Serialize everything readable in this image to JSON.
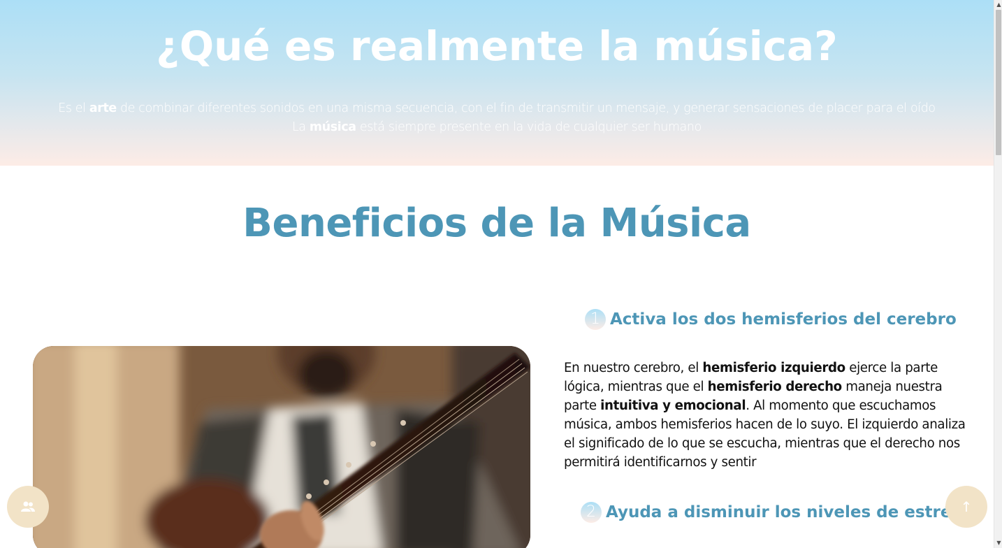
{
  "hero": {
    "title": "¿Qué es realmente la música?",
    "line1": {
      "before": "Es el ",
      "bold": "arte",
      "after": " de combinar diferentes sonidos en una misma secuencia, con el fin de transmitir un mensaje, y generar sensaciones de placer para el oído"
    },
    "line2": {
      "before": "La ",
      "bold": "música",
      "after": " está siempre presente en la vida de cualquier ser humano"
    }
  },
  "section": {
    "title": "Beneficios de la Música"
  },
  "benefits": [
    {
      "number": "1",
      "title": "Activa los dos hemisferios del cerebro",
      "body": {
        "t1": "En nuestro cerebro, el ",
        "b1": "hemisferio izquierdo",
        "t2": " ejerce la parte lógica, mientras que el ",
        "b2": "hemisferio derecho",
        "t3": " maneja nuestra parte ",
        "b3": "intuitiva y emocional",
        "t4": ". Al momento que escuchamos música, ambos hemisferios hacen de lo suyo. El izquierdo analiza el significado de lo que se escucha, mientras que el derecho nos permitirá identificarnos y sentir"
      }
    },
    {
      "number": "2",
      "title": "Ayuda a disminuir los niveles de estrés"
    }
  ],
  "buttons": {
    "left_icon": "users-icon",
    "right_icon": "arrow-up-icon",
    "right_glyph": "↑"
  },
  "colors": {
    "accent": "#4d96b6",
    "hero_top": "#acdff6",
    "hero_bottom": "#fdece6",
    "fab": "#f2e3c7"
  }
}
